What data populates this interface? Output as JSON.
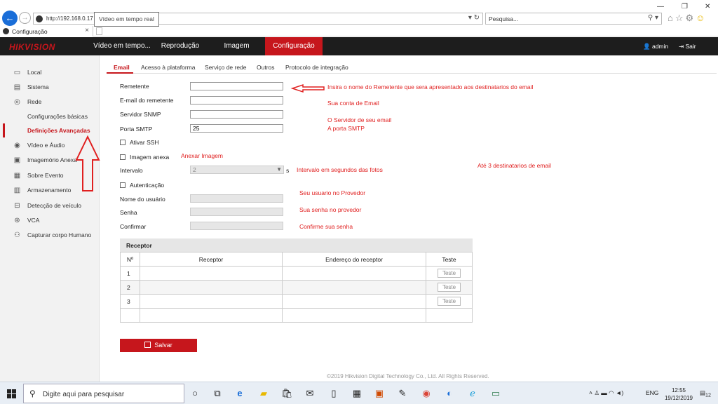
{
  "browser": {
    "url": "http://192.168.0.17",
    "tooltip": "Vídeo em tempo real",
    "search_placeholder": "Pesquisa...",
    "tab_title": "Configuração",
    "tab_close": "×",
    "icons": [
      "back-icon",
      "forward-icon",
      "refresh-icon",
      "search-icon",
      "home-icon",
      "star-icon",
      "gear-icon",
      "smiley-icon"
    ]
  },
  "header": {
    "logo": "HIKVISION",
    "nav": [
      "Vídeo em tempo...",
      "Reprodução",
      "Imagem",
      "Configuração"
    ],
    "active_nav": "Configuração",
    "user": "admin",
    "logout": "Sair"
  },
  "sidebar": {
    "items": [
      {
        "label": "Local",
        "icon": "monitor-icon"
      },
      {
        "label": "Sistema",
        "icon": "system-icon"
      },
      {
        "label": "Rede",
        "icon": "network-icon"
      },
      {
        "label": "Configurações básicas",
        "icon": ""
      },
      {
        "label": "Definições Avançadas",
        "icon": ""
      },
      {
        "label": "Vídeo e Áudio",
        "icon": "video-icon"
      },
      {
        "label": "Imagemório Anexa",
        "icon": "image-icon"
      },
      {
        "label": "Sobre Evento",
        "icon": "event-icon"
      },
      {
        "label": "Armazenamento",
        "icon": "storage-icon"
      },
      {
        "label": "Detecção de veículo",
        "icon": "vehicle-icon"
      },
      {
        "label": "VCA",
        "icon": "vca-icon"
      },
      {
        "label": "Capturar corpo Humano",
        "icon": "body-icon"
      }
    ],
    "active": "Definições Avançadas"
  },
  "subtabs": [
    "Email",
    "Acesso à plataforma",
    "Serviço de rede",
    "Outros",
    "Protocolo de integração"
  ],
  "active_subtab": "Email",
  "form": {
    "remetente_label": "Remetente",
    "remetente_value": "",
    "email_label": "E-mail do remetente",
    "email_value": "",
    "snmp_label": "Servidor SNMP",
    "snmp_value": "",
    "smtp_label": "Porta SMTP",
    "smtp_value": "25",
    "ssh_label": "Ativar SSH",
    "imagem_label": "Imagem anexa",
    "intervalo_label": "Intervalo",
    "intervalo_value": "2",
    "intervalo_unit": "s",
    "auth_label": "Autenticação",
    "usuario_label": "Nome do usuário",
    "senha_label": "Senha",
    "confirmar_label": "Confirmar"
  },
  "annotations": {
    "remetente": "Insira o nome do Remetente que sera apresentado aos destinatarios do email",
    "email": "Sua conta de Email",
    "snmp": "O Servidor de seu email",
    "smtp": "A porta SMTP",
    "imagem": "Anexar Imagem",
    "intervalo": "Intervalo em segundos das fotos",
    "destinatarios": "Até 3 destinatarios de email",
    "usuario": "Seu usuario no Provedor",
    "senha": "Sua senha no provedor",
    "confirmar": "Confirme sua senha"
  },
  "receptor": {
    "title": "Receptor",
    "headers": [
      "Nº",
      "Receptor",
      "Endereço do receptor",
      "Teste"
    ],
    "rows": [
      {
        "no": "1",
        "receptor": "",
        "endereco": "",
        "teste": "Teste"
      },
      {
        "no": "2",
        "receptor": "",
        "endereco": "",
        "teste": "Teste"
      },
      {
        "no": "3",
        "receptor": "",
        "endereco": "",
        "teste": "Teste"
      }
    ]
  },
  "save_label": "Salvar",
  "footer": "©2019 Hikvision Digital Technology Co., Ltd. All Rights Reserved.",
  "taskbar": {
    "search_placeholder": "Digite aqui para pesquisar",
    "lang": "ENG",
    "time": "12:55",
    "date": "19/12/2019",
    "notif_count": "12"
  }
}
